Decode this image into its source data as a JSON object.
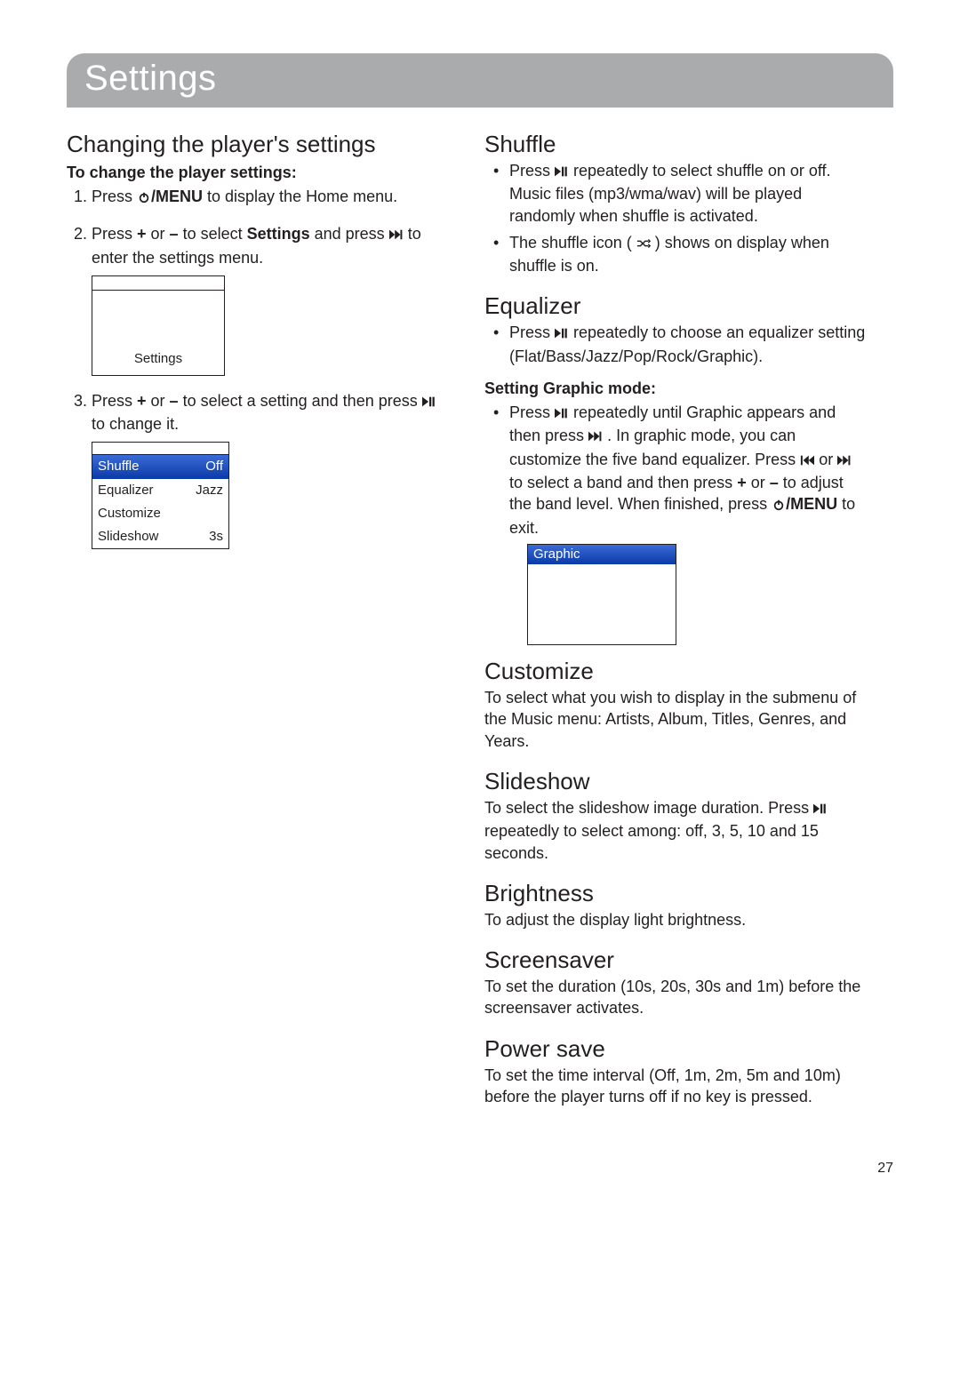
{
  "pageNumber": "27",
  "title": "Settings",
  "left": {
    "heading": "Changing the player's settings",
    "sub": "To change the player settings:",
    "step1_a": "Press ",
    "step1_menu": "/MENU",
    "step1_b": " to display the Home menu.",
    "step2_a": "Press ",
    "step2_plus": "+",
    "step2_or1": " or ",
    "step2_minus": "–",
    "step2_b": " to select ",
    "step2_settings": "Settings",
    "step2_c": " and press ",
    "step2_d": " to enter the settings menu.",
    "shot1_label": "Settings",
    "step3_a": "Press ",
    "step3_plus": "+",
    "step3_or": " or ",
    "step3_minus": "–",
    "step3_b": " to select a setting and then press ",
    "step3_c": " to change it.",
    "tbl": [
      {
        "k": "Shuffle",
        "v": "Off",
        "hl": true
      },
      {
        "k": "Equalizer",
        "v": "Jazz"
      },
      {
        "k": "Customize",
        "v": ""
      },
      {
        "k": "Slideshow",
        "v": "3s"
      }
    ]
  },
  "right": {
    "shuffle_h": "Shuffle",
    "shuffle_b1_a": "Press ",
    "shuffle_b1_b": " repeatedly to select shuffle on or off. Music files (mp3/wma/wav) will be played randomly when shuffle is activated.",
    "shuffle_b2_a": "The shuffle icon ( ",
    "shuffle_b2_b": " ) shows on display when shuffle is on.",
    "eq_h": "Equalizer",
    "eq_b1_a": "Press ",
    "eq_b1_b": " repeatedly to choose an equalizer setting (Flat/Bass/Jazz/Pop/Rock/Graphic).",
    "eq_sub": "Setting Graphic mode:",
    "eq_g_a": "Press ",
    "eq_g_b": " repeatedly until Graphic appears and then press ",
    "eq_g_c": " . In graphic mode, you can customize the five band equalizer. Press ",
    "eq_g_or": " or ",
    "eq_g_d": " to select a band and then press ",
    "eq_g_plus": "+",
    "eq_g_or2": " or ",
    "eq_g_minus": "–",
    "eq_g_e": " to adjust the band level. When finished, press ",
    "eq_g_menu": "/MENU",
    "eq_g_f": " to exit.",
    "eq_shot": "Graphic",
    "cust_h": "Customize",
    "cust_p": "To select what you wish to display in the submenu of the Music menu: Artists, Album, Titles, Genres, and Years.",
    "slide_h": "Slideshow",
    "slide_p_a": "To select the slideshow image duration. Press ",
    "slide_p_b": " repeatedly to select among: off, 3, 5, 10 and 15 seconds.",
    "bright_h": "Brightness",
    "bright_p": "To adjust the display light brightness.",
    "ss_h": "Screensaver",
    "ss_p": "To set the duration (10s, 20s, 30s and 1m) before the screensaver activates.",
    "ps_h": "Power save",
    "ps_p": "To set the time interval (Off, 1m, 2m, 5m and 10m) before the player turns off if no key is pressed."
  }
}
